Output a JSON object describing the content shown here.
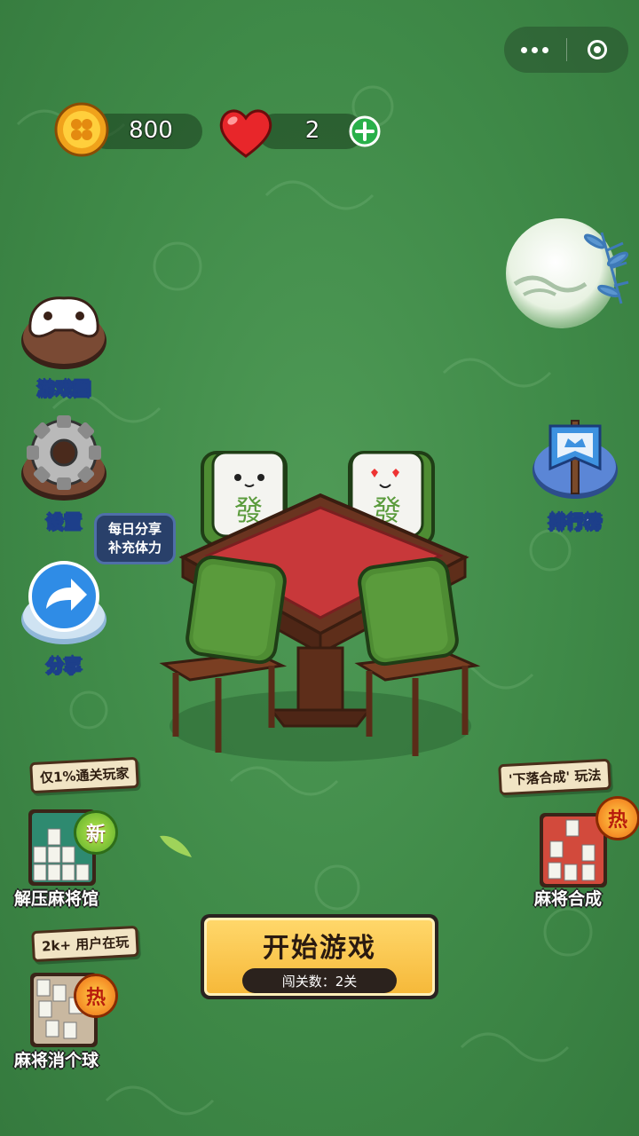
{
  "top_bar": {
    "coins": "800",
    "lives": "2"
  },
  "side_menu": {
    "game_circle": "游戏圈",
    "settings": "设置",
    "share": "分享",
    "share_bubble_line1": "每日分享",
    "share_bubble_line2": "补充体力",
    "leaderboard": "排行榜"
  },
  "promos": {
    "left_top": {
      "sign": "仅1%通关玩家",
      "badge": "新",
      "label": "解压麻将馆"
    },
    "left_bottom": {
      "sign": "2k+ 用户在玩",
      "badge": "热",
      "label": "麻将消个球"
    },
    "right": {
      "sign": "'下落合成' 玩法",
      "badge": "热",
      "label": "麻将合成"
    }
  },
  "start": {
    "title": "开始游戏",
    "level_text": "闯关数：2关"
  },
  "colors": {
    "background": "#3f8a48",
    "start_button": "#f6b93a",
    "table_top": "#c8383a",
    "tile_green": "#5a9b3c"
  }
}
